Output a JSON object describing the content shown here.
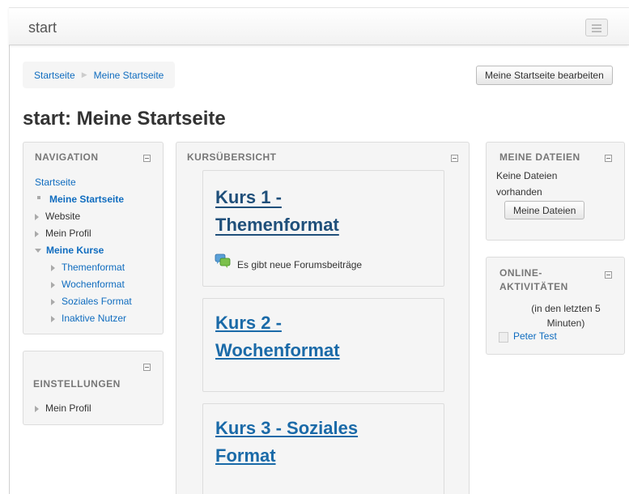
{
  "navbar": {
    "brand": "start"
  },
  "breadcrumb": {
    "items": [
      "Startseite",
      "Meine Startseite"
    ]
  },
  "header": {
    "edit_button": "Meine Startseite bearbeiten",
    "title": "start: Meine Startseite"
  },
  "navigation": {
    "title": "NAVIGATION",
    "home": "Startseite",
    "my_home": "Meine Startseite",
    "website": "Website",
    "my_profile": "Mein Profil",
    "my_courses": "Meine Kurse",
    "courses": [
      "Themenformat",
      "Wochenformat",
      "Soziales Format",
      "Inaktive Nutzer"
    ]
  },
  "settings": {
    "title": "EINSTELLUNGEN",
    "my_profile": "Mein Profil"
  },
  "course_overview": {
    "title": "KURSÜBERSICHT",
    "courses": [
      {
        "title_line1": "Kurs 1 -",
        "title_line2": "Themenformat",
        "notice": "Es gibt neue Forumsbeiträge"
      },
      {
        "title_line1": "Kurs 2 -",
        "title_line2": "Wochenformat"
      },
      {
        "title_line1": "Kurs 3 - Soziales",
        "title_line2": "Format"
      }
    ]
  },
  "my_files": {
    "title": "MEINE DATEIEN",
    "empty_line1": "Keine Dateien",
    "empty_line2": "vorhanden",
    "button": "Meine Dateien"
  },
  "online": {
    "title_line1": "ONLINE-",
    "title_line2": "AKTIVITÄTEN",
    "period_line1": "(in den letzten 5",
    "period_line2": "Minuten)",
    "users": [
      "Peter Test"
    ]
  },
  "colors": {
    "link": "#0f6cbf",
    "course_title": "#1a6aa8",
    "block_bg": "#f5f5f5"
  }
}
